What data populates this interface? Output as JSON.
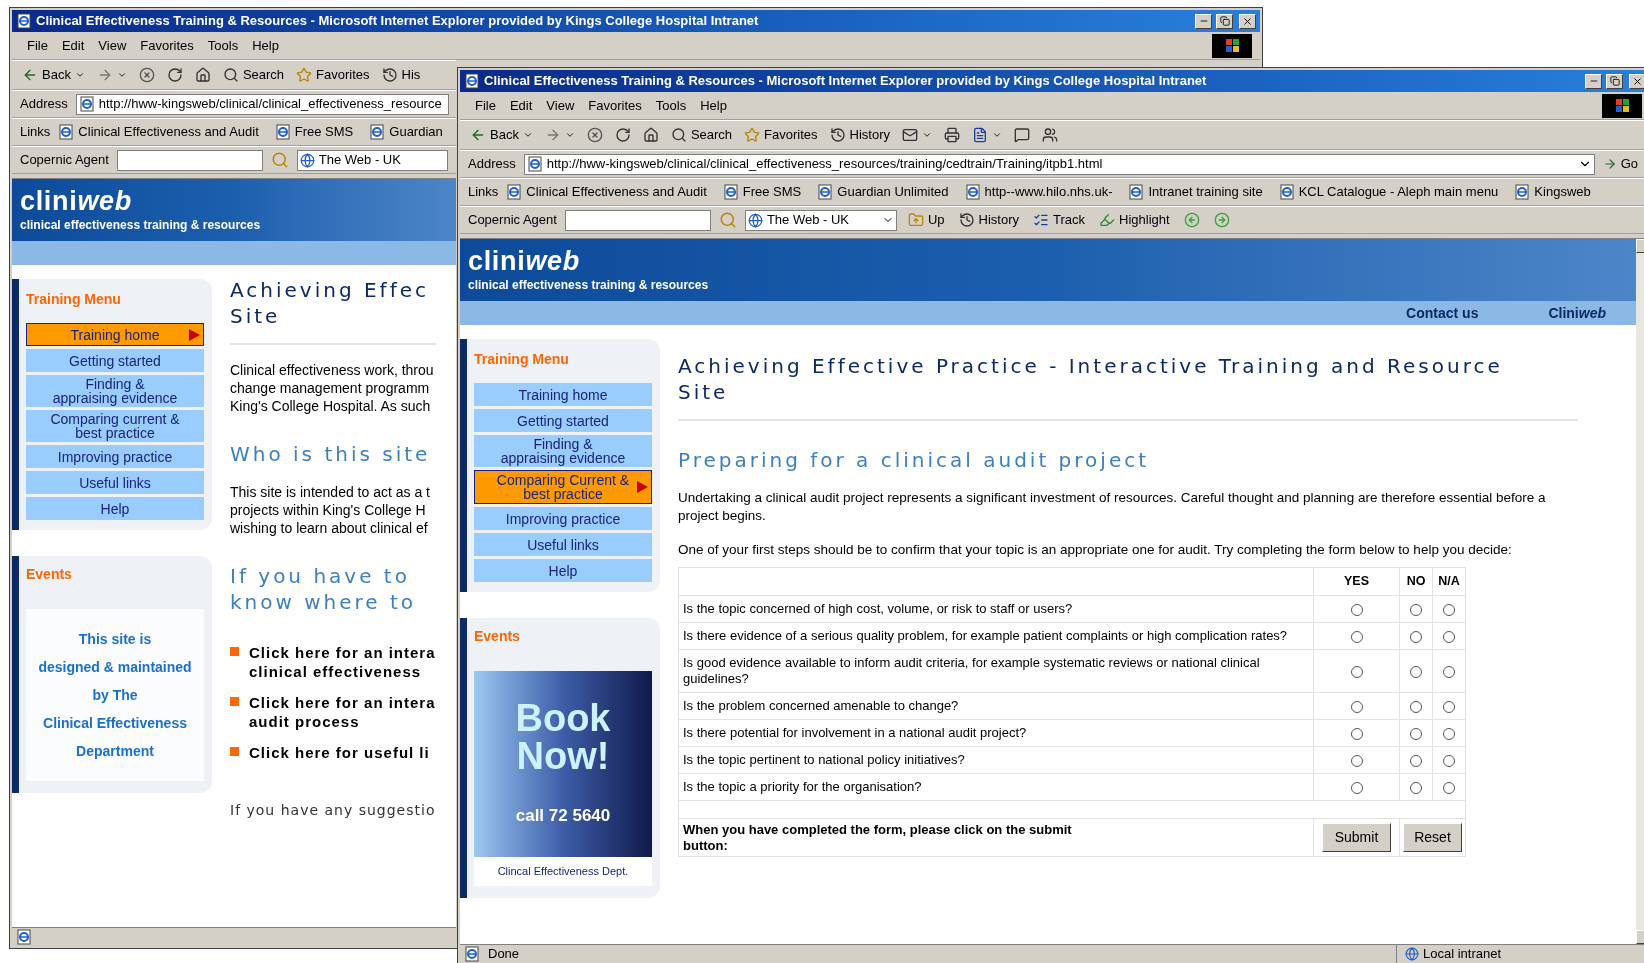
{
  "windows": [
    {
      "title": "Clinical Effectiveness Training & Resources - Microsoft Internet Explorer provided by Kings College Hospital Intranet",
      "menu": [
        "File",
        "Edit",
        "View",
        "Favorites",
        "Tools",
        "Help"
      ],
      "toolbar": [
        {
          "kind": "back",
          "label": "Back"
        },
        {
          "kind": "forward"
        },
        {
          "kind": "stop"
        },
        {
          "kind": "refresh"
        },
        {
          "kind": "home"
        },
        {
          "kind": "search",
          "label": "Search"
        },
        {
          "kind": "favorites",
          "label": "Favorites"
        },
        {
          "kind": "history",
          "label": "His"
        }
      ],
      "address": {
        "label": "Address",
        "url": "http://hww-kingsweb/clinical/clinical_effectiveness_resource"
      },
      "links": {
        "label": "Links",
        "items": [
          "Clinical Effectiveness and Audit",
          "Free SMS",
          "Guardian"
        ]
      },
      "copernic": {
        "label": "Copernic Agent",
        "engine": "The Web - UK"
      },
      "page": {
        "brand": {
          "text": "clini",
          "emphasis": "web"
        },
        "tagline": "clinical effectiveness training & resources",
        "sidebar": {
          "menu_title": "Training Menu",
          "menu": [
            {
              "label": "Training home",
              "selected": true
            },
            {
              "label": "Getting started",
              "selected": false
            },
            {
              "label": "Finding &\nappraising evidence",
              "selected": false
            },
            {
              "label": "Comparing current &\nbest practice",
              "selected": false
            },
            {
              "label": "Improving practice",
              "selected": false
            },
            {
              "label": "Useful links",
              "selected": false
            },
            {
              "label": "Help",
              "selected": false
            }
          ],
          "events_title": "Events",
          "events": {
            "kind": "text",
            "lines": [
              "This site is",
              "designed & maintained",
              "by The",
              "Clinical Effectiveness",
              "Department"
            ]
          }
        },
        "main": [
          {
            "kind": "heading",
            "lines": [
              "Achieving Effec",
              "Site"
            ]
          },
          {
            "kind": "rule"
          },
          {
            "kind": "paragraph",
            "lines": [
              "Clinical effectiveness work, throu",
              "change management programm",
              "King's College Hospital. As such"
            ]
          },
          {
            "kind": "subheading",
            "lines": [
              "Who is this site"
            ]
          },
          {
            "kind": "paragraph",
            "lines": [
              "This site is intended to act as a t",
              "projects within King's College H",
              "wishing to learn about clinical ef"
            ]
          },
          {
            "kind": "subheading",
            "lines": [
              "If you have to",
              "know where to"
            ]
          },
          {
            "kind": "bullets",
            "items": [
              {
                "lines": [
                  "Click here for an intera",
                  "clinical effectiveness"
                ]
              },
              {
                "lines": [
                  "Click here for an intera",
                  "audit process"
                ]
              },
              {
                "lines": [
                  "Click here for useful li"
                ]
              }
            ]
          },
          {
            "kind": "note",
            "lines": [
              "If you have any suggestio"
            ]
          }
        ]
      }
    },
    {
      "title": "Clinical Effectiveness Training & Resources - Microsoft Internet Explorer provided by Kings College Hospital Intranet",
      "menu": [
        "File",
        "Edit",
        "View",
        "Favorites",
        "Tools",
        "Help"
      ],
      "toolbar": [
        {
          "kind": "back",
          "label": "Back"
        },
        {
          "kind": "forward"
        },
        {
          "kind": "stop"
        },
        {
          "kind": "refresh"
        },
        {
          "kind": "home"
        },
        {
          "kind": "search",
          "label": "Search"
        },
        {
          "kind": "favorites",
          "label": "Favorites"
        },
        {
          "kind": "history",
          "label": "History"
        },
        {
          "kind": "mail"
        },
        {
          "kind": "print"
        },
        {
          "kind": "edit"
        },
        {
          "kind": "discuss"
        },
        {
          "kind": "messenger"
        }
      ],
      "address": {
        "label": "Address",
        "url": "http://hww-kingsweb/clinical/clinical_effectiveness_resources/training/cedtrain/Training/itpb1.html",
        "go": "Go"
      },
      "links": {
        "label": "Links",
        "items": [
          "Clinical Effectiveness and Audit",
          "Free SMS",
          "Guardian Unlimited",
          "http--www.hilo.nhs.uk-",
          "Intranet training site",
          "KCL Catalogue - Aleph main menu",
          "Kingsweb"
        ]
      },
      "copernic": {
        "label": "Copernic Agent",
        "engine": "The Web - UK",
        "buttons": [
          {
            "kind": "up",
            "label": "Up"
          },
          {
            "kind": "history",
            "label": "History"
          },
          {
            "kind": "track",
            "label": "Track"
          },
          {
            "kind": "highlight",
            "label": "Highlight"
          },
          {
            "kind": "prev"
          },
          {
            "kind": "next"
          }
        ]
      },
      "page": {
        "brand": {
          "text": "clini",
          "emphasis": "web"
        },
        "tagline": "clinical effectiveness training & resources",
        "nav_links": [
          {
            "text": "Contact us"
          },
          {
            "text": "Clini",
            "emphasis": "web"
          }
        ],
        "sidebar": {
          "menu_title": "Training Menu",
          "menu": [
            {
              "label": "Training home",
              "selected": false
            },
            {
              "label": "Getting started",
              "selected": false
            },
            {
              "label": "Finding &\nappraising evidence",
              "selected": false
            },
            {
              "label": "Comparing Current &\nbest practice",
              "selected": true
            },
            {
              "label": "Improving practice",
              "selected": false
            },
            {
              "label": "Useful links",
              "selected": false
            },
            {
              "label": "Help",
              "selected": false
            }
          ],
          "events_title": "Events",
          "events": {
            "kind": "banner",
            "title": "Book\nNow!",
            "phone": "call 72 5640",
            "caption": "Clincal Effectiveness Dept."
          }
        },
        "main": [
          {
            "kind": "heading",
            "lines": [
              "Achieving Effective Practice - Interactive Training and Resource",
              "Site"
            ]
          },
          {
            "kind": "rule"
          },
          {
            "kind": "subheading",
            "lines": [
              "Preparing for a clinical audit project"
            ]
          },
          {
            "kind": "paragraph",
            "text": "Undertaking a clinical audit project represents a significant investment of resources. Careful thought and planning are therefore essential before a project begins."
          },
          {
            "kind": "paragraph",
            "text": "One of your first steps should be to confirm that your topic is an appropriate one for audit. Try completing the form below to help you decide:"
          },
          {
            "kind": "form",
            "columns": [
              "YES",
              "NO",
              "N/A"
            ],
            "rows": [
              {
                "question": "Is the topic concerned of high cost, volume, or risk to staff or users?",
                "options": [
                  {
                    "selected": false
                  },
                  {
                    "selected": false
                  },
                  {
                    "selected": false
                  }
                ]
              },
              {
                "question": "Is there evidence of a serious quality problem, for example patient complaints or high complication rates?",
                "options": [
                  {
                    "selected": false
                  },
                  {
                    "selected": false
                  },
                  {
                    "selected": false
                  }
                ]
              },
              {
                "question": "Is good evidence available to inform audit criteria, for example systematic reviews or national clinical guidelines?",
                "options": [
                  {
                    "selected": false
                  },
                  {
                    "selected": false
                  },
                  {
                    "selected": false
                  }
                ]
              },
              {
                "question": "Is the problem concerned amenable to change?",
                "options": [
                  {
                    "selected": false
                  },
                  {
                    "selected": false
                  },
                  {
                    "selected": false
                  }
                ]
              },
              {
                "question": "Is there potential for involvement in a national audit project?",
                "options": [
                  {
                    "selected": false
                  },
                  {
                    "selected": false
                  },
                  {
                    "selected": false
                  }
                ]
              },
              {
                "question": "Is the topic pertinent to national policy initiatives?",
                "options": [
                  {
                    "selected": false
                  },
                  {
                    "selected": false
                  },
                  {
                    "selected": false
                  }
                ]
              },
              {
                "question": "Is the topic a priority for the organisation?",
                "options": [
                  {
                    "selected": false
                  },
                  {
                    "selected": false
                  },
                  {
                    "selected": false
                  }
                ]
              }
            ],
            "footer": "When you have completed the form, please click on the submit button:",
            "buttons": [
              "Submit",
              "Reset"
            ]
          }
        ]
      },
      "status": {
        "text": "Done",
        "zone": "Local intranet"
      }
    }
  ]
}
